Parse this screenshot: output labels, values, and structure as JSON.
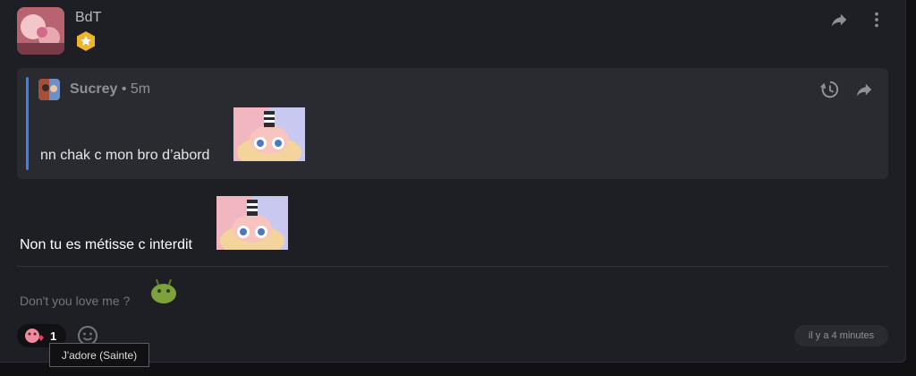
{
  "post": {
    "author": "BdT",
    "badge_icon": "star-badge-icon",
    "actions": [
      "share-icon",
      "more-options-icon"
    ]
  },
  "quote": {
    "author": "Sucrey",
    "separator": "•",
    "time": "5m",
    "text": "nn chak c mon bro d’abord",
    "actions": [
      "history-icon",
      "share-icon"
    ]
  },
  "message": {
    "text": "Non tu es métisse c interdit"
  },
  "signature": {
    "text": "Don't you love me ?"
  },
  "reactions": {
    "count": "1",
    "tooltip": "J'adore (Sainte)"
  },
  "timestamp": "il y a 4 minutes",
  "colors": {
    "background": "#1e1f24",
    "quote_bg": "#2a2b31",
    "quote_accent": "#3b82f6",
    "badge_gold": "#f0b429"
  }
}
